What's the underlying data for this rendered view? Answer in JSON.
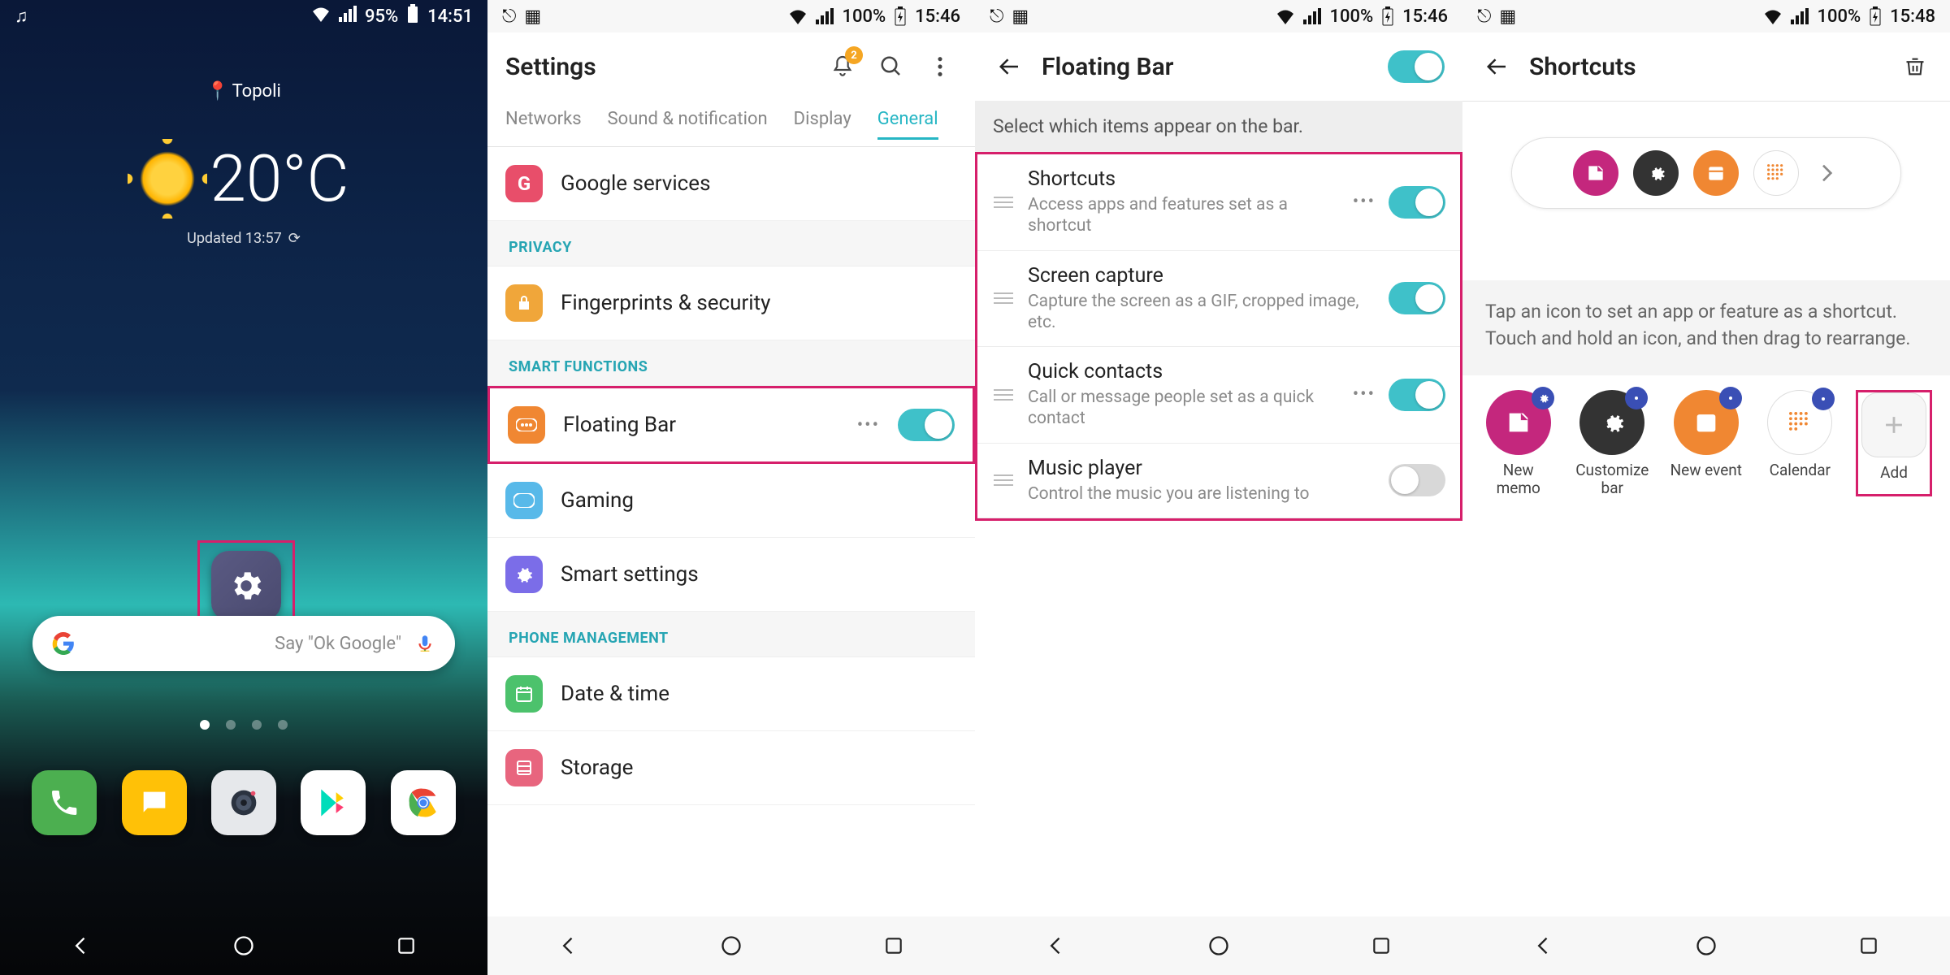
{
  "screen1": {
    "status": {
      "battery": "95%",
      "time": "14:51"
    },
    "location": "Topoli",
    "temperature": "20°C",
    "updated": "Updated 13:57",
    "settings_label": "Settings",
    "search_placeholder": "Say \"Ok Google\"",
    "dock": [
      "Phone",
      "Messaging",
      "Camera",
      "Play Store",
      "Chrome"
    ]
  },
  "screen2": {
    "status": {
      "battery": "100%",
      "time": "15:46"
    },
    "title": "Settings",
    "notif_badge": "2",
    "tabs": [
      "Networks",
      "Sound & notification",
      "Display",
      "General"
    ],
    "active_tab": "General",
    "sections": {
      "top": {
        "items": [
          {
            "id": "google",
            "label": "Google services",
            "color": "#e84e6a"
          }
        ]
      },
      "privacy": {
        "label": "PRIVACY",
        "items": [
          {
            "id": "fp",
            "label": "Fingerprints & security",
            "color": "#f0a63a"
          }
        ]
      },
      "smart": {
        "label": "SMART FUNCTIONS",
        "items": [
          {
            "id": "floatingbar",
            "label": "Floating Bar",
            "color": "#f08732",
            "switch": true,
            "on": true,
            "ellipsis": true,
            "highlight": true
          },
          {
            "id": "gaming",
            "label": "Gaming",
            "color": "#58b9e9"
          },
          {
            "id": "smartsettings",
            "label": "Smart settings",
            "color": "#7b6de8"
          }
        ]
      },
      "phonemgmt": {
        "label": "PHONE MANAGEMENT",
        "items": [
          {
            "id": "datetime",
            "label": "Date & time",
            "color": "#4cc26c"
          },
          {
            "id": "storage",
            "label": "Storage",
            "color": "#e8657e"
          }
        ]
      }
    }
  },
  "screen3": {
    "status": {
      "battery": "100%",
      "time": "15:46"
    },
    "title": "Floating Bar",
    "master_on": true,
    "subtitle": "Select which items appear on the bar.",
    "items": [
      {
        "id": "shortcuts",
        "title": "Shortcuts",
        "desc": "Access apps and features set as a shortcut",
        "on": true,
        "ellipsis": true
      },
      {
        "id": "screencap",
        "title": "Screen capture",
        "desc": "Capture the screen as a GIF, cropped image, etc.",
        "on": true
      },
      {
        "id": "quickcontacts",
        "title": "Quick contacts",
        "desc": "Call or message people set as a quick contact",
        "on": true,
        "ellipsis": true
      },
      {
        "id": "music",
        "title": "Music player",
        "desc": "Control the music you are listening to",
        "on": false
      }
    ]
  },
  "screen4": {
    "status": {
      "battery": "100%",
      "time": "15:48"
    },
    "title": "Shortcuts",
    "hint": "Tap an icon to set an app or feature as a shortcut. Touch and hold an icon, and then drag to rearrange.",
    "quickbar": [
      "memo",
      "customize",
      "event",
      "calendar"
    ],
    "apps": [
      {
        "id": "memo",
        "label": "New memo",
        "bg": "#c4277d",
        "badge": true
      },
      {
        "id": "customize",
        "label": "Customize bar",
        "bg": "#333",
        "badge": true
      },
      {
        "id": "event",
        "label": "New event",
        "bg": "#f08732",
        "badge": true
      },
      {
        "id": "calendar",
        "label": "Calendar",
        "bg": "#fff",
        "border": true,
        "badge": true
      },
      {
        "id": "add",
        "label": "Add",
        "highlight": true
      }
    ]
  }
}
